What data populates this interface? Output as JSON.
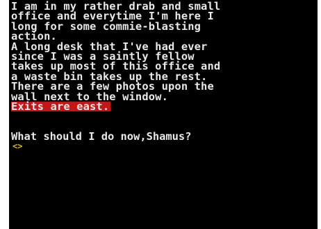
{
  "screen": {
    "description_lines": [
      "I am in my rather drab and small",
      "office and everytime I'm here I",
      "long for some commie-blasting",
      "action.",
      "A long desk that I've had ever",
      "since I was a saintly fellow",
      "takes up most of this office and",
      "a waste bin takes up the rest.",
      "There are a few photos upon the",
      "wall next to the window."
    ],
    "exits": "Exits are east.",
    "prompt": "What should I do now,Shamus?",
    "input_cursor": "<>"
  },
  "colors": {
    "background": "#000000",
    "text": "#e8e8e8",
    "exits_highlight": "#c41616",
    "cursor": "#d8c000"
  }
}
